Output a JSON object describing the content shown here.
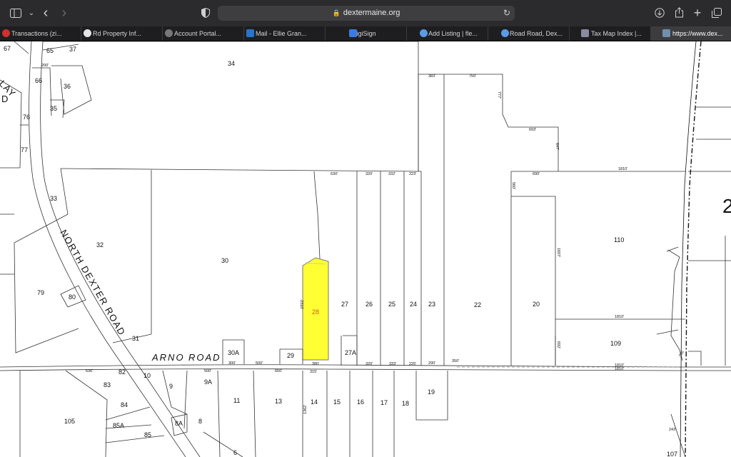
{
  "browser": {
    "url": "dextermaine.org",
    "tabs": [
      {
        "label": "Transactions (zi...",
        "color": "#d0312d",
        "active": false
      },
      {
        "label": "Rd Property Inf...",
        "color": "#e6e6e6",
        "active": false
      },
      {
        "label": "Account Portal...",
        "color": "#777777",
        "active": false
      },
      {
        "label": "Mail - Ellie Gran...",
        "color": "#2b72c9",
        "active": false
      },
      {
        "label": "DigiSign",
        "color": "#3b7be0",
        "active": false
      },
      {
        "label": "Add Listing | fle...",
        "color": "#5a9be8",
        "active": false
      },
      {
        "label": "Road Road, Dex...",
        "color": "#5a9be8",
        "active": false
      },
      {
        "label": "Tax Map Index |...",
        "color": "#8a8aa0",
        "active": false
      },
      {
        "label": "https://www.dex...",
        "color": "#6f8fb0",
        "active": true
      }
    ],
    "icons": {
      "sidebar": "sidebar-icon",
      "back": "chevron-left-icon",
      "forward": "chevron-right-icon",
      "shield": "shield-icon",
      "lock": "lock-icon",
      "reload": "reload-icon",
      "download": "download-icon",
      "share": "share-icon",
      "new_tab": "plus-icon",
      "tab_overview": "tabs-overview-icon"
    }
  },
  "map": {
    "highlight_color": "#ffff33",
    "highlight_label_color": "#d05a2a",
    "road_labels": {
      "north_dexter": "NORTH DEXTER ROAD",
      "arno": "ARNO",
      "arno_road": "ROAD",
      "partial_top_left": "LAY",
      "partial_top_left2": "D"
    },
    "lots": {
      "l67": "67",
      "l65": "65",
      "l37": "37",
      "l66": "66",
      "l36": "36",
      "l35": "35",
      "l76": "76",
      "l77": "77",
      "l34": "34",
      "l33": "33",
      "l32": "32",
      "l79": "79",
      "l80": "80",
      "l30": "30",
      "l31": "31",
      "l28": "28",
      "l27": "27",
      "l26": "26",
      "l25": "25",
      "l24": "24",
      "l23": "23",
      "l22": "22",
      "l20": "20",
      "l110": "110",
      "l109": "109",
      "l30A": "30A",
      "l29": "29",
      "l27A": "27A",
      "l82": "82",
      "l10": "10",
      "l83": "83",
      "l9": "9",
      "l9A": "9A",
      "l11": "11",
      "l13": "13",
      "l14": "14",
      "l15": "15",
      "l16": "16",
      "l17": "17",
      "l18": "18",
      "l19": "19",
      "l84": "84",
      "l105": "105",
      "l85A": "85A",
      "l85": "85",
      "l8A": "8A",
      "l8": "8",
      "l6": "6",
      "l107": "107",
      "l2": "2"
    },
    "dims": {
      "d200": "200'",
      "d630": "630'",
      "d320": "320'",
      "d332": "332'",
      "d223": "223'",
      "d383": "383'",
      "d750": "750'",
      "d777": "777'",
      "d693": "693'",
      "d647": "647'",
      "d1810": "1810'",
      "d690": "690'",
      "d560": "560'",
      "d1607": "1607'",
      "d1810b": "1810'",
      "d692": "692'",
      "d1810c": "1810'",
      "d700": "700'",
      "d2310": "2310'",
      "d650": "650'",
      "d300": "300'",
      "d500": "500'",
      "d380": "380'",
      "d315": "315'",
      "d320b": "320'",
      "d333": "333'",
      "d225": "225'",
      "d290": "290'",
      "d350": "350'",
      "d636": "636'",
      "d500b": "500'",
      "d1810d": "1810'",
      "d1362": "1362'",
      "d243": "243'"
    }
  }
}
